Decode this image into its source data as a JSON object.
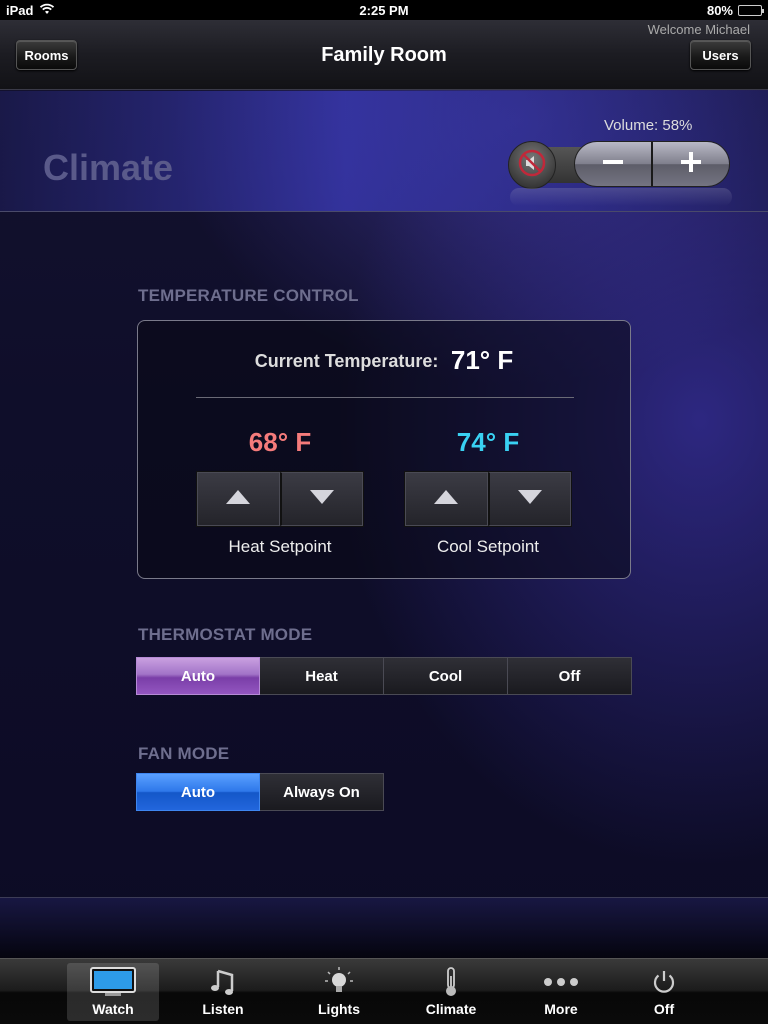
{
  "status_bar": {
    "device": "iPad",
    "time": "2:25 PM",
    "battery": "80%",
    "battery_level": 0.8
  },
  "nav": {
    "rooms_label": "Rooms",
    "title": "Family Room",
    "users_label": "Users",
    "welcome": "Welcome Michael"
  },
  "header": {
    "section_title": "Climate",
    "volume_label": "Volume: 58%",
    "volume_level": 0.58,
    "mute_icon": "speaker-muted-icon",
    "volume_down_icon": "minus-icon",
    "volume_up_icon": "plus-icon"
  },
  "temperature": {
    "heading": "TEMPERATURE CONTROL",
    "current_label": "Current Temperature:",
    "current_value": "71° F",
    "heat_value": "68° F",
    "heat_color": "#f57b7b",
    "heat_label": "Heat Setpoint",
    "cool_value": "74° F",
    "cool_color": "#39d1f2",
    "cool_label": "Cool Setpoint"
  },
  "thermostat_mode": {
    "heading": "THERMOSTAT MODE",
    "options": [
      "Auto",
      "Heat",
      "Cool",
      "Off"
    ],
    "selected": "Auto",
    "accent": "#a274c8"
  },
  "fan_mode": {
    "heading": "FAN MODE",
    "options": [
      "Auto",
      "Always On"
    ],
    "selected": "Auto",
    "accent": "#2e78ea"
  },
  "tabs": [
    {
      "label": "Watch",
      "icon": "tv-icon",
      "selected": true
    },
    {
      "label": "Listen",
      "icon": "music-note-icon",
      "selected": false
    },
    {
      "label": "Lights",
      "icon": "light-bulb-icon",
      "selected": false
    },
    {
      "label": "Climate",
      "icon": "thermometer-icon",
      "selected": false
    },
    {
      "label": "More",
      "icon": "more-dots-icon",
      "selected": false
    },
    {
      "label": "Off",
      "icon": "power-icon",
      "selected": false
    }
  ]
}
